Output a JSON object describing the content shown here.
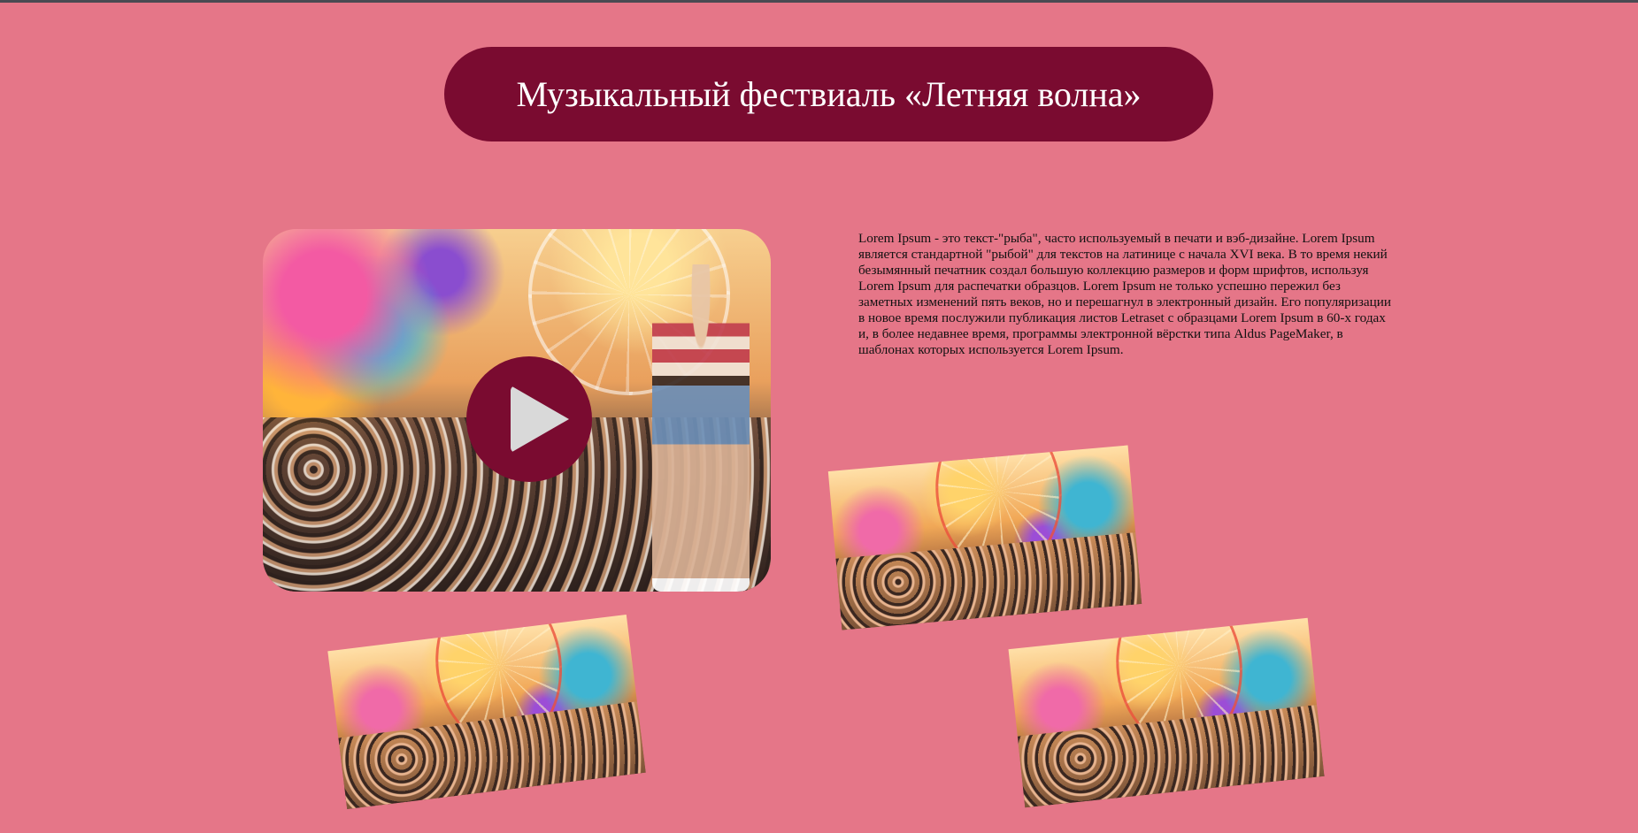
{
  "header": {
    "title": "Музыкальный фествиаль «Летняя волна»"
  },
  "description": "Lorem Ipsum - это текст-\"рыба\", часто используемый в печати и вэб-дизайне. Lorem Ipsum является стандартной \"рыбой\" для текстов на латинице с начала XVI века. В то время некий безымянный печатник создал большую коллекцию размеров и форм шрифтов, используя Lorem Ipsum для распечатки образцов. Lorem Ipsum не только успешно пережил без заметных изменений пять веков, но и перешагнул в электронный дизайн. Его популяризации в новое время послужили публикация листов Letraset с образцами Lorem Ipsum в 60-х годах и, в более недавнее время, программы электронной вёрстки типа Aldus PageMaker, в шаблонах которых используется Lorem Ipsum.",
  "colors": {
    "background": "#e57688",
    "accent": "#7a0b30",
    "play_triangle": "#d9d9d9"
  },
  "icons": {
    "play": "play-icon"
  }
}
